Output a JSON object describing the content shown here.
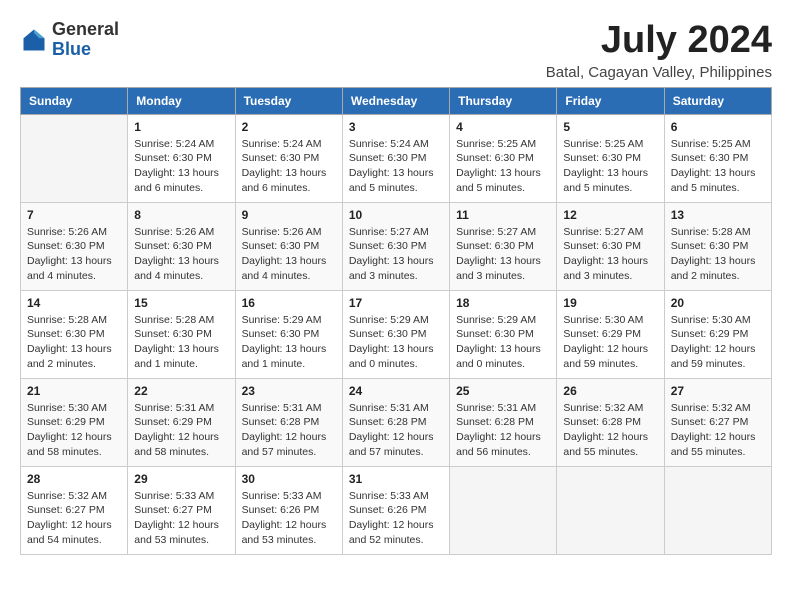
{
  "logo": {
    "general": "General",
    "blue": "Blue"
  },
  "title": "July 2024",
  "location": "Batal, Cagayan Valley, Philippines",
  "days_of_week": [
    "Sunday",
    "Monday",
    "Tuesday",
    "Wednesday",
    "Thursday",
    "Friday",
    "Saturday"
  ],
  "weeks": [
    [
      {
        "day": "",
        "info": ""
      },
      {
        "day": "1",
        "info": "Sunrise: 5:24 AM\nSunset: 6:30 PM\nDaylight: 13 hours\nand 6 minutes."
      },
      {
        "day": "2",
        "info": "Sunrise: 5:24 AM\nSunset: 6:30 PM\nDaylight: 13 hours\nand 6 minutes."
      },
      {
        "day": "3",
        "info": "Sunrise: 5:24 AM\nSunset: 6:30 PM\nDaylight: 13 hours\nand 5 minutes."
      },
      {
        "day": "4",
        "info": "Sunrise: 5:25 AM\nSunset: 6:30 PM\nDaylight: 13 hours\nand 5 minutes."
      },
      {
        "day": "5",
        "info": "Sunrise: 5:25 AM\nSunset: 6:30 PM\nDaylight: 13 hours\nand 5 minutes."
      },
      {
        "day": "6",
        "info": "Sunrise: 5:25 AM\nSunset: 6:30 PM\nDaylight: 13 hours\nand 5 minutes."
      }
    ],
    [
      {
        "day": "7",
        "info": "Sunrise: 5:26 AM\nSunset: 6:30 PM\nDaylight: 13 hours\nand 4 minutes."
      },
      {
        "day": "8",
        "info": "Sunrise: 5:26 AM\nSunset: 6:30 PM\nDaylight: 13 hours\nand 4 minutes."
      },
      {
        "day": "9",
        "info": "Sunrise: 5:26 AM\nSunset: 6:30 PM\nDaylight: 13 hours\nand 4 minutes."
      },
      {
        "day": "10",
        "info": "Sunrise: 5:27 AM\nSunset: 6:30 PM\nDaylight: 13 hours\nand 3 minutes."
      },
      {
        "day": "11",
        "info": "Sunrise: 5:27 AM\nSunset: 6:30 PM\nDaylight: 13 hours\nand 3 minutes."
      },
      {
        "day": "12",
        "info": "Sunrise: 5:27 AM\nSunset: 6:30 PM\nDaylight: 13 hours\nand 3 minutes."
      },
      {
        "day": "13",
        "info": "Sunrise: 5:28 AM\nSunset: 6:30 PM\nDaylight: 13 hours\nand 2 minutes."
      }
    ],
    [
      {
        "day": "14",
        "info": "Sunrise: 5:28 AM\nSunset: 6:30 PM\nDaylight: 13 hours\nand 2 minutes."
      },
      {
        "day": "15",
        "info": "Sunrise: 5:28 AM\nSunset: 6:30 PM\nDaylight: 13 hours\nand 1 minute."
      },
      {
        "day": "16",
        "info": "Sunrise: 5:29 AM\nSunset: 6:30 PM\nDaylight: 13 hours\nand 1 minute."
      },
      {
        "day": "17",
        "info": "Sunrise: 5:29 AM\nSunset: 6:30 PM\nDaylight: 13 hours\nand 0 minutes."
      },
      {
        "day": "18",
        "info": "Sunrise: 5:29 AM\nSunset: 6:30 PM\nDaylight: 13 hours\nand 0 minutes."
      },
      {
        "day": "19",
        "info": "Sunrise: 5:30 AM\nSunset: 6:29 PM\nDaylight: 12 hours\nand 59 minutes."
      },
      {
        "day": "20",
        "info": "Sunrise: 5:30 AM\nSunset: 6:29 PM\nDaylight: 12 hours\nand 59 minutes."
      }
    ],
    [
      {
        "day": "21",
        "info": "Sunrise: 5:30 AM\nSunset: 6:29 PM\nDaylight: 12 hours\nand 58 minutes."
      },
      {
        "day": "22",
        "info": "Sunrise: 5:31 AM\nSunset: 6:29 PM\nDaylight: 12 hours\nand 58 minutes."
      },
      {
        "day": "23",
        "info": "Sunrise: 5:31 AM\nSunset: 6:28 PM\nDaylight: 12 hours\nand 57 minutes."
      },
      {
        "day": "24",
        "info": "Sunrise: 5:31 AM\nSunset: 6:28 PM\nDaylight: 12 hours\nand 57 minutes."
      },
      {
        "day": "25",
        "info": "Sunrise: 5:31 AM\nSunset: 6:28 PM\nDaylight: 12 hours\nand 56 minutes."
      },
      {
        "day": "26",
        "info": "Sunrise: 5:32 AM\nSunset: 6:28 PM\nDaylight: 12 hours\nand 55 minutes."
      },
      {
        "day": "27",
        "info": "Sunrise: 5:32 AM\nSunset: 6:27 PM\nDaylight: 12 hours\nand 55 minutes."
      }
    ],
    [
      {
        "day": "28",
        "info": "Sunrise: 5:32 AM\nSunset: 6:27 PM\nDaylight: 12 hours\nand 54 minutes."
      },
      {
        "day": "29",
        "info": "Sunrise: 5:33 AM\nSunset: 6:27 PM\nDaylight: 12 hours\nand 53 minutes."
      },
      {
        "day": "30",
        "info": "Sunrise: 5:33 AM\nSunset: 6:26 PM\nDaylight: 12 hours\nand 53 minutes."
      },
      {
        "day": "31",
        "info": "Sunrise: 5:33 AM\nSunset: 6:26 PM\nDaylight: 12 hours\nand 52 minutes."
      },
      {
        "day": "",
        "info": ""
      },
      {
        "day": "",
        "info": ""
      },
      {
        "day": "",
        "info": ""
      }
    ]
  ]
}
